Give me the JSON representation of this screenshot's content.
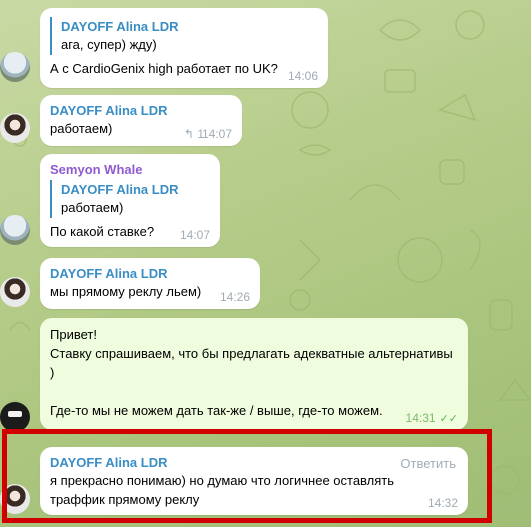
{
  "colors": {
    "sender_blue": "#3a8ec4",
    "sender_purple": "#8e5bd0",
    "highlight_red": "#d10000",
    "outgoing_bubble": "#effdde",
    "incoming_bubble": "#ffffff"
  },
  "messages": [
    {
      "reply_name": "DAYOFF Alina LDR",
      "reply_text": "ага, супер) жду)",
      "text": "А с CardioGenix high работает по UK?",
      "time": "14:06"
    },
    {
      "sender": "DAYOFF Alina LDR",
      "text": "работаем)",
      "reply_count": "1",
      "time": "14:07"
    },
    {
      "sender": "Semyon Whale",
      "reply_name": "DAYOFF Alina LDR",
      "reply_text": "работаем)",
      "text": "По какой ставке?",
      "time": "14:07"
    },
    {
      "sender": "DAYOFF Alina LDR",
      "text": "мы прямому реклу льем)",
      "time": "14:26"
    },
    {
      "text": "Привет!\nСтавку спрашиваем, что бы предлагать адекватные альтернативы )\n\nГде-то мы не можем дать так-же / выше, где-то можем.",
      "time": "14:31"
    },
    {
      "sender": "DAYOFF Alina LDR",
      "action": "Ответить",
      "text": "я прекрасно понимаю) но думаю что логичнее оставлять траффик прямому реклу",
      "time": "14:32"
    }
  ]
}
